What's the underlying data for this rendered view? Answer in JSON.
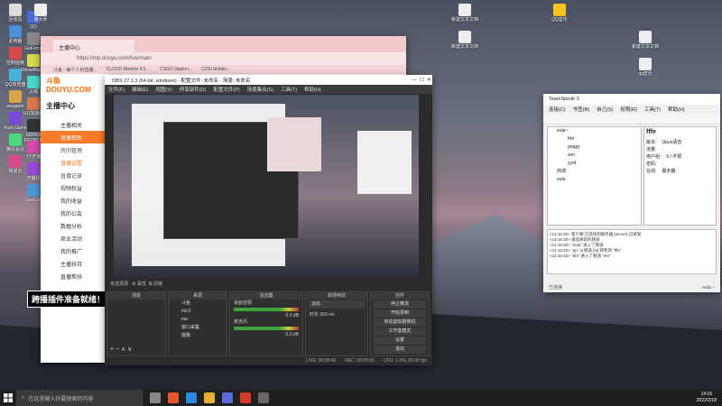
{
  "desktop": {
    "icons_left": [
      "回收站",
      "此电脑",
      "控制面板",
      "QQ浏览器",
      "wegame",
      "Rain Game",
      "腾讯会议",
      "网易云",
      "QQ",
      "GeForce",
      "iShowPlayer",
      "火绒",
      "UU加速器",
      "SUPER PEOPLE CBT",
      "YY开播",
      "开播机",
      "GeeGee"
    ],
    "icons_top": [
      "魔大师",
      "新建文本文档",
      "新建文本文档",
      "QQ音乐",
      "新建文本文档",
      "qq音乐"
    ]
  },
  "browser": {
    "tab_label": "主播中心",
    "url": "https://mp.douyu.com/live/main",
    "bookmarks": [
      "斗鱼 - 每个人的直播...",
      "CLOUD Monitor 4.5 ...",
      "CSGO Station...",
      "CZGI Mobile..."
    ]
  },
  "douyu": {
    "logo": "斗鱼 DOUYU.COM",
    "header": "主播中心",
    "menu": [
      {
        "label": "主播相关",
        "type": "group"
      },
      {
        "label": "直播相关",
        "type": "active"
      },
      {
        "label": "房间管理",
        "type": "sub"
      },
      {
        "label": "直播设置",
        "type": "selected"
      },
      {
        "label": "直播记录",
        "type": "sub"
      },
      {
        "label": "视频权益",
        "type": "group"
      },
      {
        "label": "我的收益",
        "type": "group"
      },
      {
        "label": "我的公会",
        "type": "group"
      },
      {
        "label": "数据分析",
        "type": "group"
      },
      {
        "label": "商业活动",
        "type": "group"
      },
      {
        "label": "我的推广",
        "type": "group"
      },
      {
        "label": "主播扶持",
        "type": "group"
      },
      {
        "label": "直播帮扶",
        "type": "group"
      }
    ]
  },
  "overlay_text": "跨播插件准备就绪！",
  "obs": {
    "title": "OBS 27.1.3 (64-bit, windows) - 配置文件: 未命名 - 场景: 未命名",
    "menu": [
      "文件(F)",
      "编辑(E)",
      "视图(V)",
      "停靠部件(D)",
      "配置文件(P)",
      "场景集合(S)",
      "工具(T)",
      "帮助(H)"
    ],
    "status_left": "未选择源",
    "prop_btn": "属性",
    "filter_btn": "滤镜",
    "docks": {
      "scenes": "场景",
      "sources": "来源",
      "mixer": "混音器",
      "transitions": "转场特效",
      "controls": "控件"
    },
    "sources": [
      "斗鱼",
      "mic2",
      "mic",
      "窗口采集",
      "摄像"
    ],
    "mixer_items": [
      {
        "label": "桌面音频",
        "db": "0.0 dB"
      },
      {
        "label": "麦克风",
        "db": "0.0 dB"
      }
    ],
    "transition": {
      "type": "淡出",
      "duration_label": "时长",
      "duration": "300 ms"
    },
    "controls": [
      "停止推流",
      "开始录制",
      "启动虚拟摄像机",
      "工作室模式",
      "设置",
      "退出"
    ],
    "footer": [
      "LIVE: 00:08:43",
      "REC: 00:00:00",
      "CPU: 1.0%, 60.00 fps"
    ]
  },
  "teamspeak": {
    "title": "TeamSpeak 3",
    "menu": [
      "连接(C)",
      "书签(B)",
      "自己(S)",
      "权限(R)",
      "工具(T)",
      "帮助(H)"
    ],
    "tree": [
      "eula~",
      "frfe",
      "peggy",
      "sen",
      "yyrd",
      "商城",
      "eula"
    ],
    "info": {
      "name": "fffe",
      "rows": [
        {
          "k": "版本:",
          "v": "Opus语音"
        },
        {
          "k": "流量:",
          "v": "-"
        },
        {
          "k": "用户组:",
          "v": "5 / 不限"
        },
        {
          "k": "密码:",
          "v": "-"
        },
        {
          "k": "在线:",
          "v": "服务器"
        }
      ]
    },
    "chat": [
      "<14:16:30> 客户端 已连接到服务器 [server] 已接受",
      "<14:16:30> 请选择您的频道",
      "<14:16:30> \"eula\" 进入了频道",
      "<14:16:40> \"pp\" 从频道 [ts] 转移到 \"fffe\"",
      "<14:16:45> \"ebi\" 进入了频道 \"ebi\""
    ],
    "bottom_left": "已连接",
    "bottom_right": "eula ~"
  },
  "taskbar": {
    "search_placeholder": "在这里输入你要搜索的内容",
    "time": "14:16",
    "date": "2022/2/18"
  }
}
